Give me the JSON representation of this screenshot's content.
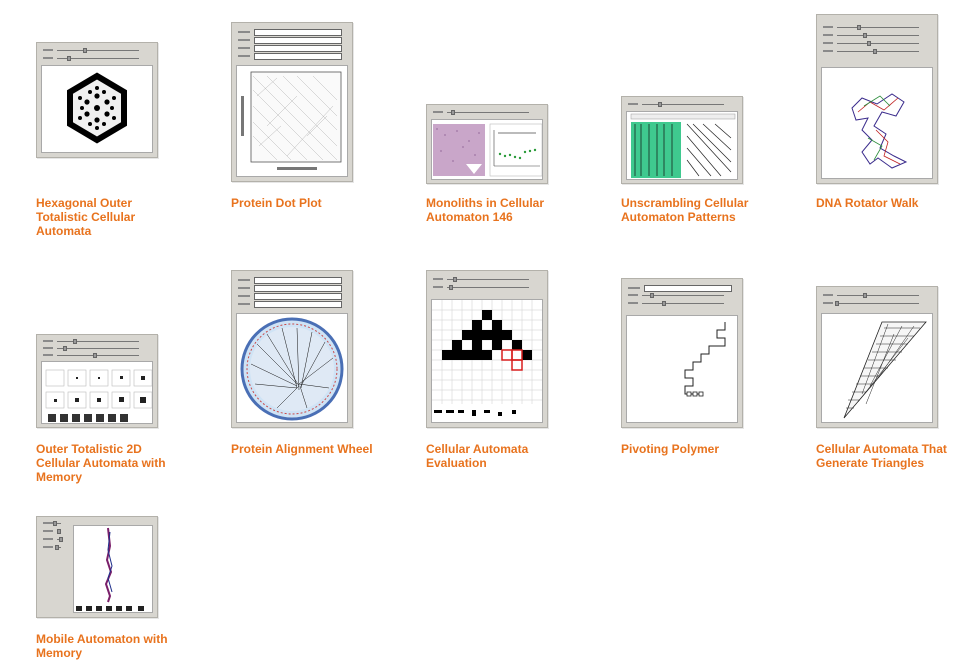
{
  "gallery": {
    "items": [
      {
        "title": "Hexagonal Outer Totalistic Cellular Automata"
      },
      {
        "title": "Protein Dot Plot"
      },
      {
        "title": "Monoliths in Cellular Automaton 146"
      },
      {
        "title": "Unscrambling Cellular Automaton Patterns"
      },
      {
        "title": "DNA Rotator Walk"
      },
      {
        "title": "Outer Totalistic 2D Cellular Automata with Memory"
      },
      {
        "title": "Protein Alignment Wheel"
      },
      {
        "title": "Cellular Automata Evaluation"
      },
      {
        "title": "Pivoting Polymer"
      },
      {
        "title": "Cellular Automata That Generate Triangles"
      },
      {
        "title": "Mobile Automaton with Memory"
      }
    ]
  },
  "colors": {
    "caption": "#e8731e",
    "thumb_frame": "#d8d6d0"
  }
}
